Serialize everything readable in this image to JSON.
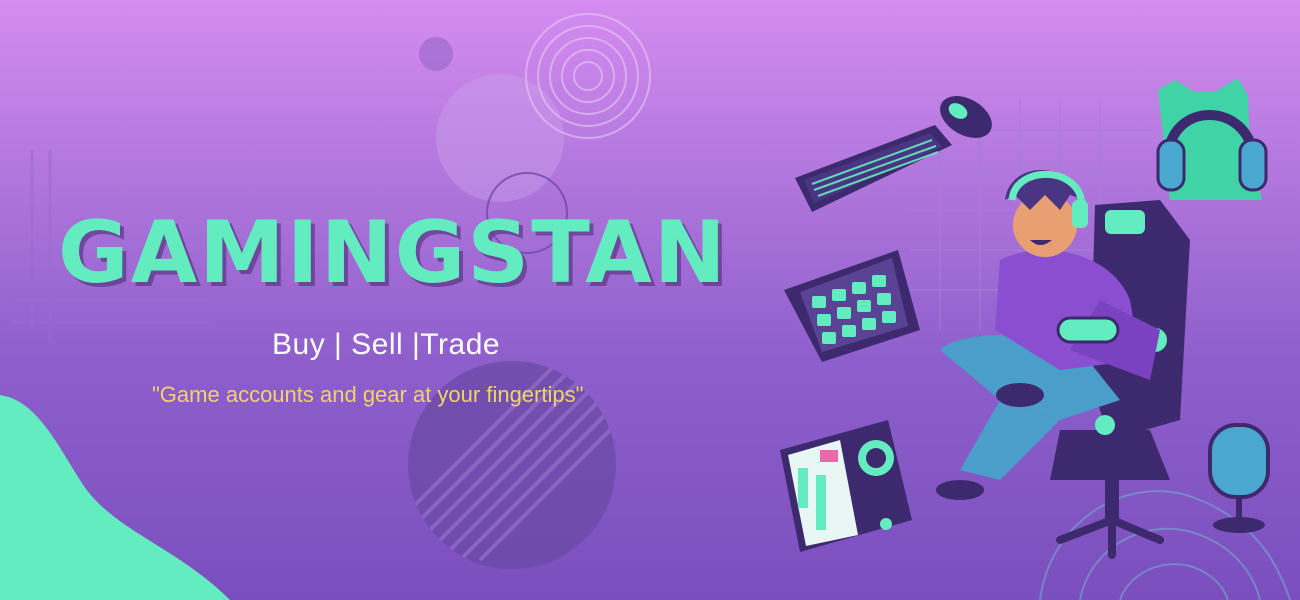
{
  "brand": {
    "title": "GAMINGSTAN",
    "tagline": "Buy | Sell |Trade",
    "slogan": "\"Game accounts and gear at your fingertips\""
  },
  "colors": {
    "accent": "#62ecc0",
    "slogan": "#f0d466",
    "bg_top": "#d58cf0",
    "bg_bottom": "#7a4fbd",
    "ink": "#3d2a6e"
  },
  "icons": [
    "keyboard-icon",
    "mouse-icon",
    "headphones-icon",
    "stream-deck-icon",
    "pc-tower-icon",
    "microphone-icon",
    "gamer-character-icon"
  ]
}
